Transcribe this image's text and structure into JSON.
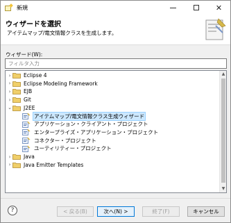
{
  "window": {
    "title": "新規"
  },
  "header": {
    "title": "ウィザードを選択",
    "description": "アイテムマップ/電文情報クラスを生成します。"
  },
  "wizard_label": "ウィザード(W):",
  "filter": {
    "placeholder": "フィルタ入力",
    "value": ""
  },
  "tree": [
    {
      "label": "Eclipse 4",
      "level": 0,
      "expanded": false,
      "kind": "folder"
    },
    {
      "label": "Eclipse Modeling Framework",
      "level": 0,
      "expanded": false,
      "kind": "folder"
    },
    {
      "label": "EJB",
      "level": 0,
      "expanded": false,
      "kind": "folder"
    },
    {
      "label": "Git",
      "level": 0,
      "expanded": false,
      "kind": "folder"
    },
    {
      "label": "J2EE",
      "level": 0,
      "expanded": true,
      "kind": "folder"
    },
    {
      "label": "アイテムマップ/電文情報クラス生成ウィザード",
      "level": 1,
      "kind": "wizard",
      "selected": true
    },
    {
      "label": "アプリケーション・クライアント・プロジェクト",
      "level": 1,
      "kind": "wizard"
    },
    {
      "label": "エンタープライズ・アプリケーション・プロジェクト",
      "level": 1,
      "kind": "wizard"
    },
    {
      "label": "コネクター・プロジェクト",
      "level": 1,
      "kind": "wizard"
    },
    {
      "label": "ユーティリティー・プロジェクト",
      "level": 1,
      "kind": "wizard"
    },
    {
      "label": "Java",
      "level": 0,
      "expanded": false,
      "kind": "folder"
    },
    {
      "label": "Java Emitter Templates",
      "level": 0,
      "expanded": false,
      "kind": "folder"
    }
  ],
  "buttons": {
    "help": "?",
    "back": "< 戻る(B)",
    "next": "次へ(N) >",
    "finish": "終了(F)",
    "cancel": "キャンセル"
  },
  "colors": {
    "selection": "#cce8ff",
    "folder": "#e8c060",
    "default_button_border": "#0078d7"
  }
}
